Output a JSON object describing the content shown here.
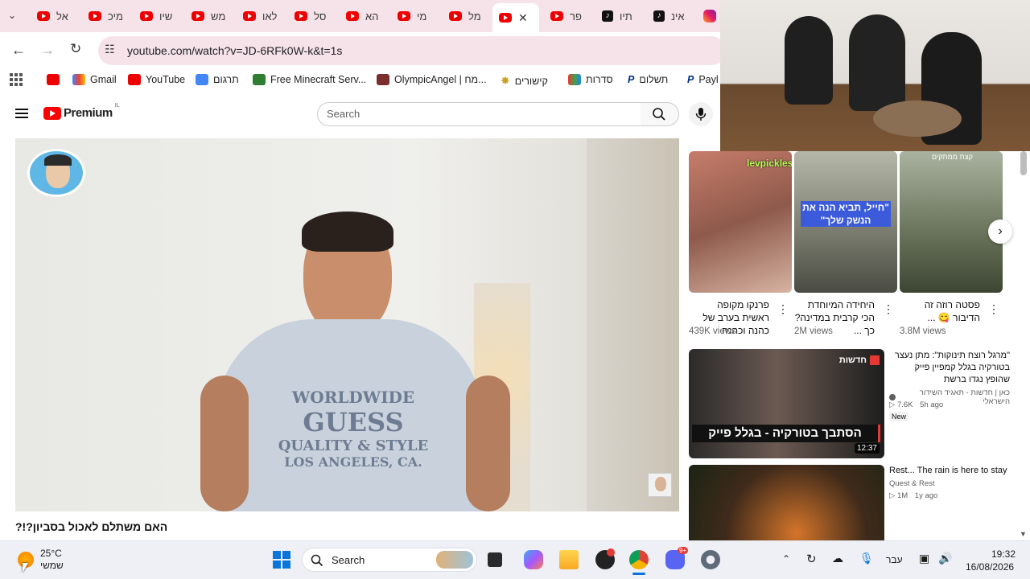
{
  "tabs": [
    {
      "label": "אל",
      "icon": "youtube-icon"
    },
    {
      "label": "מיכ",
      "icon": "youtube-icon"
    },
    {
      "label": "שיו",
      "icon": "youtube-icon"
    },
    {
      "label": "מש",
      "icon": "youtube-icon"
    },
    {
      "label": "לאו",
      "icon": "youtube-icon"
    },
    {
      "label": "סל",
      "icon": "youtube-icon"
    },
    {
      "label": "הא",
      "icon": "youtube-icon"
    },
    {
      "label": "מי",
      "icon": "youtube-icon"
    },
    {
      "label": "מל",
      "icon": "youtube-icon"
    },
    {
      "label": "",
      "icon": "youtube-icon",
      "active": true
    },
    {
      "label": "פר",
      "icon": "youtube-icon"
    },
    {
      "label": "תיו",
      "icon": "tiktok-icon"
    },
    {
      "label": "אינ",
      "icon": "tiktok-icon"
    },
    {
      "label": "",
      "icon": "instagram-icon"
    }
  ],
  "address": {
    "url": "youtube.com/watch?v=JD-6RFk0W-k&t=1s"
  },
  "bookmarks": [
    {
      "label": "",
      "icon": "youtube-icon"
    },
    {
      "label": "Gmail",
      "icon": "gmail-icon"
    },
    {
      "label": "YouTube",
      "icon": "youtube-icon"
    },
    {
      "label": "תרגום",
      "icon": "translate-icon"
    },
    {
      "label": "Free Minecraft Serv...",
      "icon": "minecraft-icon"
    },
    {
      "label": "OlympicAngel | מח...",
      "icon": "profile-icon"
    },
    {
      "label": "קישורים",
      "icon": "folder-icon"
    },
    {
      "label": "סדרות",
      "icon": "tv-icon"
    },
    {
      "label": "תשלום",
      "icon": "paypal-icon"
    },
    {
      "label": "Payl",
      "icon": "paypal-icon"
    }
  ],
  "youtube": {
    "logo": "Premium",
    "country": "IL",
    "search_placeholder": "Search",
    "video_title": "האם משתלם לאכול בסביון?!?",
    "shirt_lines": [
      "WORLDWIDE",
      "GUESS",
      "QUALITY & STYLE",
      "LOS ANGELES, CA."
    ]
  },
  "shorts": [
    {
      "title": "פרנקו מקופה ראשית בערב של כהנה וכהנה",
      "views": "439K views",
      "overlay": "levpickles"
    },
    {
      "title": "היחידה המיוחדת הכי קרבית במדינה? כך ...",
      "views": "2M views",
      "overlay": "\"חייל, תביא הנה את הנשק שלך\""
    },
    {
      "title": "פסטה רוזה זה הדיבור 😋 ...",
      "views": "3.8M views",
      "overlay": "קצת ממתקים"
    }
  ],
  "recommendations": [
    {
      "title": "\"מרגל רוצח תינוקות\": מתן נעצר בטורקיה בגלל קמפיין פייק שהופץ נגדו ברשת",
      "channel": "כאן | חדשות - תאגיד השידור הישראלי",
      "verified": true,
      "views": "7.6K",
      "age": "5h ago",
      "badge": "New",
      "duration": "12:37",
      "thumb_caption": "הסתבך בטורקיה - בגלל פייק",
      "thumb_tag": "חדשות"
    },
    {
      "title": "Rest... The rain is here to stay",
      "channel": "Quest & Rest",
      "views": "1M",
      "age": "1y ago"
    }
  ],
  "taskbar": {
    "weather_temp": "25°C",
    "weather_desc": "שמשי",
    "search_label": "Search",
    "language": "עבר",
    "time": "19:32",
    "date": "16/08/2026",
    "discord_badge": "9+"
  },
  "colors": {
    "youtube_red": "#ff0000",
    "tab_strip": "#f6e3ea",
    "taskbar": "#eef0f6"
  }
}
